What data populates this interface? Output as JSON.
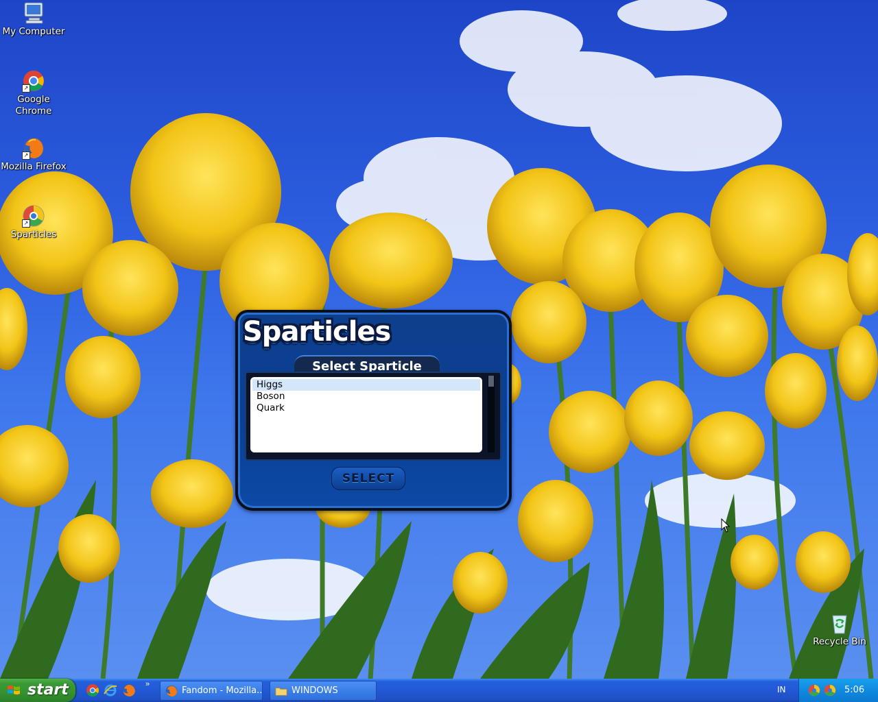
{
  "desktop": {
    "icons": [
      {
        "label": "My Computer",
        "icon": "my-computer-icon"
      },
      {
        "label": "Google Chrome",
        "icon": "chrome-icon"
      },
      {
        "label": "Mozilla Firefox",
        "icon": "firefox-icon"
      },
      {
        "label": "Sparticles",
        "icon": "sparticles-shortcut-icon"
      },
      {
        "label": "Recycle Bin",
        "icon": "recycle-bin-icon"
      }
    ]
  },
  "dialog": {
    "logo": "Sparticles",
    "subtitle": "Select Sparticle",
    "items": [
      "Higgs",
      "Boson",
      "Quark"
    ],
    "selected_item": "Higgs",
    "select_button": "SELECT"
  },
  "taskbar": {
    "start_label": "start",
    "quick_launch": [
      "chrome-icon",
      "internet-explorer-icon",
      "firefox-icon"
    ],
    "more_label": "»",
    "tasks": [
      {
        "label": "Fandom - Mozilla...",
        "icon": "firefox-icon"
      },
      {
        "label": "WINDOWS",
        "icon": "folder-icon"
      }
    ],
    "language": "IN",
    "clock": "5:06"
  },
  "colors": {
    "sky": "#2d5fe0",
    "tulip": "#f2c417",
    "dialog_blue": "#0a3f95",
    "taskbar_blue": "#2258d6",
    "start_green": "#35922f"
  }
}
